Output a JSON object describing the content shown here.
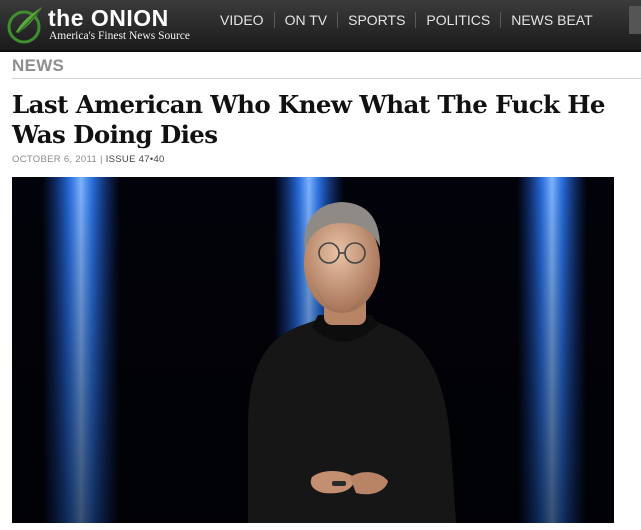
{
  "site": {
    "logo_text": "the ONION",
    "tagline": "America's Finest News Source"
  },
  "nav": {
    "items": [
      {
        "label": "VIDEO"
      },
      {
        "label": "ON TV"
      },
      {
        "label": "SPORTS"
      },
      {
        "label": "POLITICS"
      },
      {
        "label": "NEWS BEAT"
      }
    ]
  },
  "article": {
    "section": "NEWS",
    "headline": "Last American Who Knew What The Fuck He Was Doing Dies",
    "date": "OCTOBER 6, 2011",
    "issue": "ISSUE 47•40"
  },
  "colors": {
    "topbar": "#262626",
    "logo_green": "#3f8f2f",
    "stage_blue": "#2f7fff",
    "section_gray": "#8e8e8e"
  }
}
